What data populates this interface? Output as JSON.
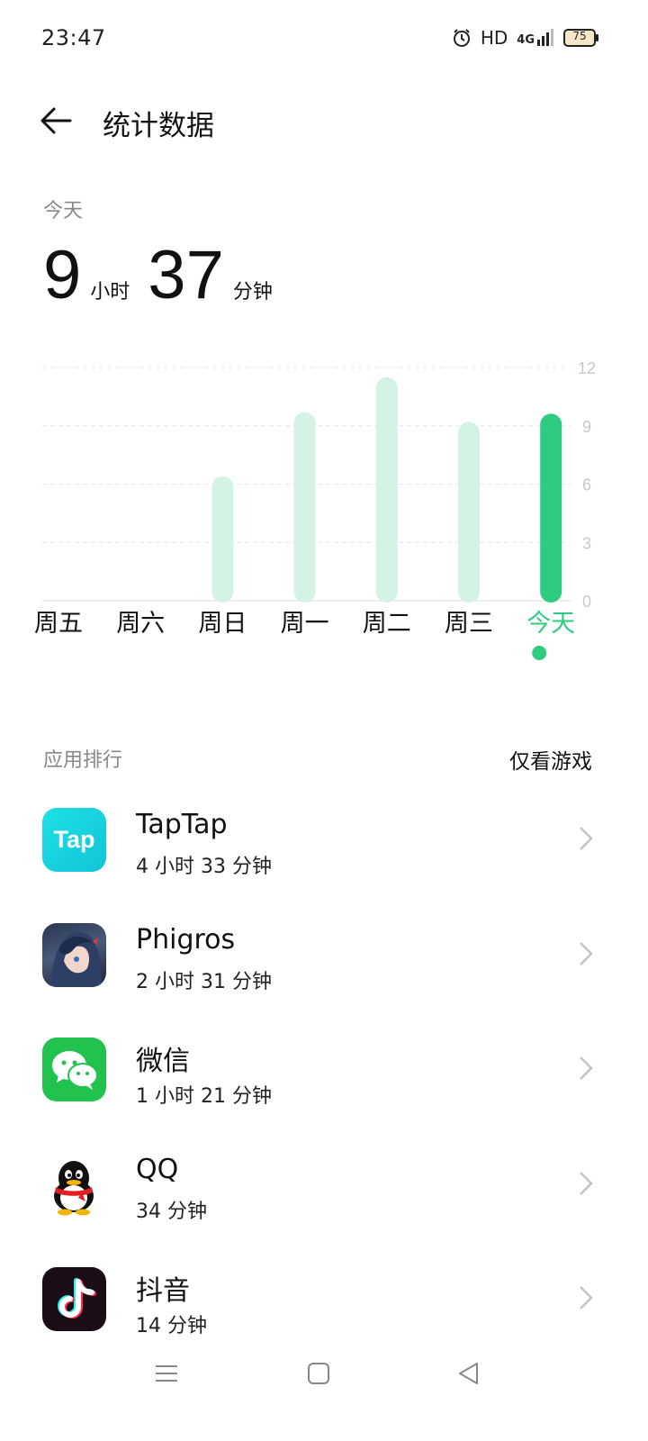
{
  "status_bar": {
    "time": "23:47",
    "hd": "HD",
    "network": "4G",
    "battery": "75"
  },
  "header": {
    "title": "统计数据"
  },
  "summary": {
    "label": "今天",
    "hours": "9",
    "hours_unit": "小时",
    "minutes": "37",
    "minutes_unit": "分钟"
  },
  "chart_data": {
    "type": "bar",
    "categories": [
      "周五",
      "周六",
      "周日",
      "周一",
      "周二",
      "周三",
      "今天"
    ],
    "values": [
      0,
      0,
      6.4,
      9.7,
      11.5,
      9.2,
      9.62
    ],
    "ylim": [
      0,
      12
    ],
    "yticks": [
      "12",
      "9",
      "6",
      "3",
      "0"
    ],
    "selected_index": 6,
    "grid": true,
    "colors": {
      "bar": "#d4f3e4",
      "selected": "#2dcc80",
      "label": "#111111",
      "selected_label": "#2dcc80",
      "tick": "#c8c8c8"
    }
  },
  "ranking": {
    "label": "应用排行",
    "filter_label": "仅看游戏",
    "apps": [
      {
        "name": "TapTap",
        "time": "4 小时 33 分钟",
        "icon": "taptap-icon",
        "icon_text": "Tap"
      },
      {
        "name": "Phigros",
        "time": "2 小时 31 分钟",
        "icon": "phigros-icon"
      },
      {
        "name": "微信",
        "time": "1 小时 21 分钟",
        "icon": "wechat-icon"
      },
      {
        "name": "QQ",
        "time": "34 分钟",
        "icon": "qq-icon"
      },
      {
        "name": "抖音",
        "time": "14 分钟",
        "icon": "douyin-icon"
      }
    ]
  },
  "nav_bar": {
    "buttons": [
      "menu-icon",
      "home-icon",
      "back-triangle-icon"
    ]
  }
}
